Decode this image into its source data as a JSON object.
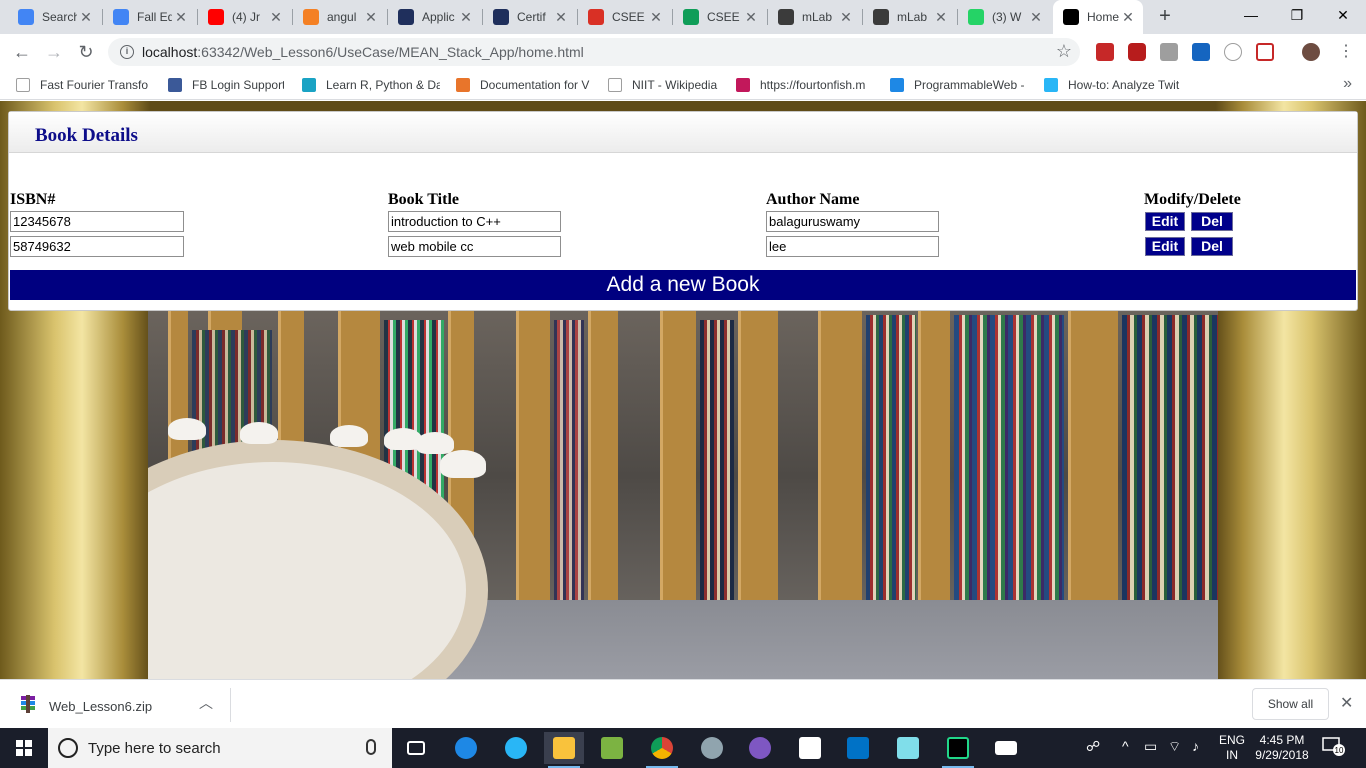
{
  "browser": {
    "tabs": [
      {
        "title": "Search",
        "icon": "google-icon",
        "color": "#4285f4"
      },
      {
        "title": "Fall Ed",
        "icon": "google-icon",
        "color": "#4285f4"
      },
      {
        "title": "(4) Jr",
        "icon": "youtube-icon",
        "color": "#ff0000"
      },
      {
        "title": "angul",
        "icon": "stackoverflow-icon",
        "color": "#f48024"
      },
      {
        "title": "Applic",
        "icon": "pega-icon",
        "color": "#1f2f5c"
      },
      {
        "title": "Certif",
        "icon": "pega-icon",
        "color": "#1f2f5c"
      },
      {
        "title": "CSEE",
        "icon": "gmail-icon",
        "color": "#d93025"
      },
      {
        "title": "CSEE",
        "icon": "sheets-icon",
        "color": "#0f9d58"
      },
      {
        "title": "mLab",
        "icon": "mlab-icon",
        "color": "#3b3b3b"
      },
      {
        "title": "mLab",
        "icon": "mlab-icon",
        "color": "#3b3b3b"
      },
      {
        "title": "(3) W",
        "icon": "whatsapp-icon",
        "color": "#25d366"
      },
      {
        "title": "Home",
        "icon": "webstorm-icon",
        "color": "#000000",
        "active": true
      }
    ],
    "tab_close": "✕",
    "new_tab": "+",
    "window_controls": {
      "minimize": "—",
      "maximize": "❐",
      "close": "✕"
    },
    "address": {
      "host": "localhost",
      "path": ":63342/Web_Lesson6/UseCase/MEAN_Stack_App/home.html"
    },
    "bookmarks": [
      {
        "label": "Fast Fourier Transform",
        "icon": "document-icon",
        "color": "#ffffff"
      },
      {
        "label": "FB Login Support",
        "icon": "facebook-icon",
        "color": "#3b5998"
      },
      {
        "label": "Learn R, Python & Da",
        "icon": "shield-icon",
        "color": "#1aa3c4"
      },
      {
        "label": "Documentation for V",
        "icon": "vscode-icon",
        "color": "#e8752b"
      },
      {
        "label": "NIIT - Wikipedia",
        "icon": "wikipedia-icon",
        "color": "#ffffff"
      },
      {
        "label": "https://fourtonfish.m",
        "icon": "m-circle-icon",
        "color": "#c2185b"
      },
      {
        "label": "ProgrammableWeb -",
        "icon": "puzzle-icon",
        "color": "#1e88e5"
      },
      {
        "label": "How-to: Analyze Twit",
        "icon": "c-icon",
        "color": "#29b6f6"
      }
    ],
    "bookmarks_more": "»"
  },
  "page": {
    "panel_title": "Book Details",
    "columns": [
      "ISBN#",
      "Book Title",
      "Author Name",
      "Modify/Delete"
    ],
    "books": [
      {
        "isbn": "12345678",
        "title": "introduction to C++",
        "author": "balaguruswamy"
      },
      {
        "isbn": "58749632",
        "title": "web mobile cc",
        "author": "lee"
      }
    ],
    "edit_label": "Edit",
    "delete_label": "Del",
    "add_button": "Add a new Book"
  },
  "downloads": {
    "file_name": "Web_Lesson6.zip",
    "show_all": "Show all",
    "close": "✕"
  },
  "taskbar": {
    "search_placeholder": "Type here to search",
    "language": "ENG",
    "region": "IN",
    "time": "4:45 PM",
    "date": "9/29/2018",
    "notification_count": "10"
  }
}
